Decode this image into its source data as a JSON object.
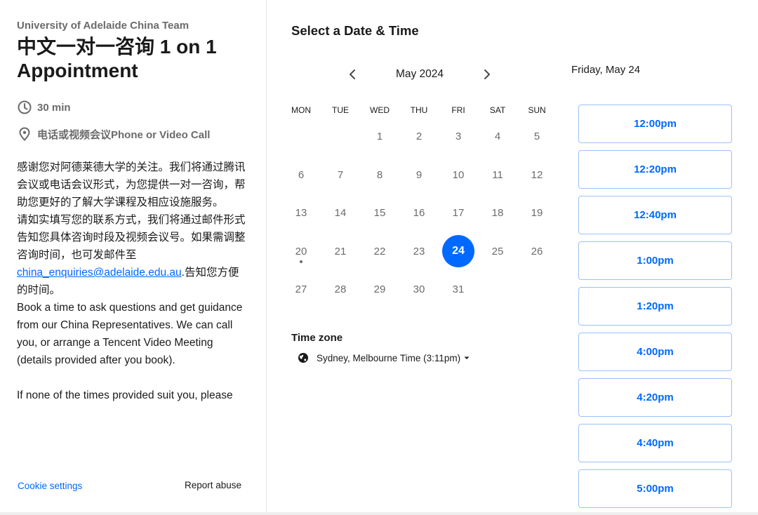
{
  "event": {
    "organizer": "University of Adelaide China Team",
    "title": "中文一对一咨询 1 on 1 Appointment",
    "duration": "30 min",
    "location": "电话或视频会议Phone or Video Call",
    "description": {
      "cn_p1": "感谢您对阿德莱德大学的关注。我们将通过腾讯会议或电话会议形式，为您提供一对一咨询，帮助您更好的了解大学课程及相应设施服务。",
      "cn_p2_before": "请如实填写您的联系方式，我们将通过邮件形式告知您具体咨询时段及视频会议号。如果需调整咨询时间，也可发邮件至",
      "email": "china_enquiries@adelaide.edu.au",
      "cn_p2_after": ".告知您方便的时间。",
      "en_p1": "Book a time to ask questions and get guidance from our China Representatives. We can call you, or arrange a Tencent Video Meeting (details provided after you book).",
      "en_p2": "If none of the times provided suit you, please"
    }
  },
  "footer": {
    "cookie_settings": "Cookie settings",
    "report_abuse": "Report abuse"
  },
  "calendar": {
    "section_title": "Select a Date & Time",
    "month_label": "May 2024",
    "weekdays": [
      "MON",
      "TUE",
      "WED",
      "THU",
      "FRI",
      "SAT",
      "SUN"
    ],
    "first_weekday_index": 2,
    "days_in_month": 31,
    "today": 20,
    "selected_day": 24
  },
  "timezone": {
    "label": "Time zone",
    "value": "Sydney, Melbourne Time (3:11pm)"
  },
  "slots": {
    "selected_date": "Friday, May 24",
    "times": [
      "12:00pm",
      "12:20pm",
      "12:40pm",
      "1:00pm",
      "1:20pm",
      "4:00pm",
      "4:20pm",
      "4:40pm",
      "5:00pm"
    ]
  },
  "colors": {
    "accent": "#0069ff",
    "muted_text": "#6b6b6b",
    "slot_border": "#9ac2fa"
  },
  "icons": {
    "duration": "clock-icon",
    "location": "map-pin-icon",
    "prev": "chevron-left-icon",
    "next": "chevron-right-icon",
    "timezone": "globe-icon",
    "dropdown": "caret-down-icon"
  }
}
